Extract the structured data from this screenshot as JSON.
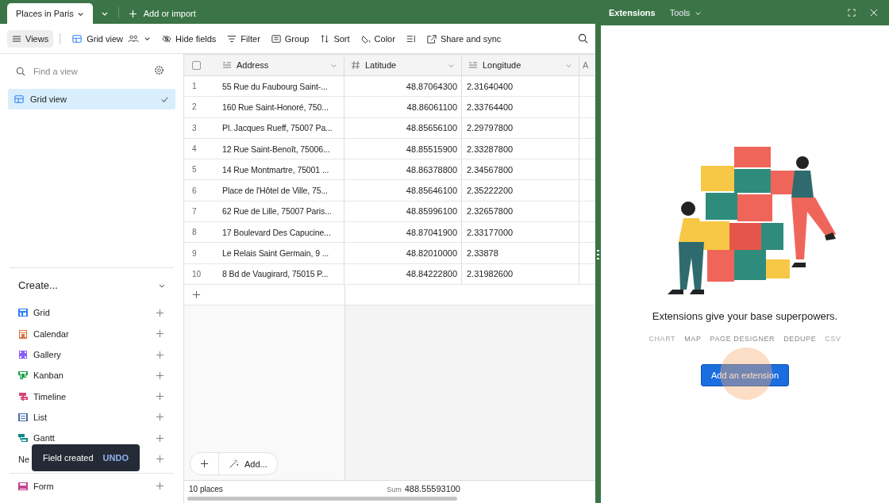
{
  "base_tabs": [
    {
      "label": "Places in Paris",
      "selected": true
    }
  ],
  "add_import": "Add or import",
  "toolbar": {
    "views": "Views",
    "view_name": "Grid view",
    "actions": [
      {
        "label": "Hide fields",
        "kind": "hide"
      },
      {
        "label": "Filter",
        "kind": "filter"
      },
      {
        "label": "Group",
        "kind": "group"
      },
      {
        "label": "Sort",
        "kind": "sort"
      },
      {
        "label": "Color",
        "kind": "color"
      },
      {
        "kind": "height"
      },
      {
        "label": "Share and sync",
        "kind": "share"
      }
    ]
  },
  "sidebar": {
    "search_placeholder": "Find a view",
    "views": [
      {
        "label": "Grid view",
        "selected": true
      }
    ],
    "create_title": "Create...",
    "create_items": [
      {
        "label": "Grid",
        "kind": "grid",
        "color": "#2d7ff9"
      },
      {
        "label": "Calendar",
        "kind": "calendar",
        "color": "#d9733f"
      },
      {
        "label": "Gallery",
        "kind": "gallery",
        "color": "#8b5cf6"
      },
      {
        "label": "Kanban",
        "kind": "kanban",
        "color": "#20a34a"
      },
      {
        "label": "Timeline",
        "kind": "timeline",
        "color": "#d6457a"
      },
      {
        "label": "List",
        "kind": "list",
        "color": "#4a6fa5"
      },
      {
        "label": "Gantt",
        "kind": "gantt",
        "color": "#0f8a8a"
      },
      {
        "label": "Ne"
      }
    ],
    "other_items": [
      {
        "label": "Form",
        "kind": "form",
        "color": "#c2458f"
      }
    ]
  },
  "toast": {
    "message": "Field created",
    "action": "UNDO"
  },
  "table": {
    "all_selected": false,
    "columns": [
      {
        "name": "Address",
        "kind": "text"
      },
      {
        "name": "Latitude",
        "kind": "number"
      },
      {
        "name": "Longitude",
        "kind": "text"
      },
      {
        "name": "A",
        "kind": "cut"
      }
    ],
    "rows": [
      {
        "n": "1",
        "address": "55 Rue du Faubourg Saint-...",
        "lat": "48.87064300",
        "lon": "2.31640400"
      },
      {
        "n": "2",
        "address": "160 Rue Saint-Honoré, 750...",
        "lat": "48.86061100",
        "lon": "2.33764400"
      },
      {
        "n": "3",
        "address": "Pl. Jacques Rueff, 75007 Pa...",
        "lat": "48.85656100",
        "lon": "2.29797800"
      },
      {
        "n": "4",
        "address": "12 Rue Saint-Benoît, 75006...",
        "lat": "48.85515900",
        "lon": "2.33287800"
      },
      {
        "n": "5",
        "address": "14 Rue Montmartre, 75001 ...",
        "lat": "48.86378800",
        "lon": "2.34567800"
      },
      {
        "n": "6",
        "address": "Place de l'Hôtel de Ville, 75...",
        "lat": "48.85646100",
        "lon": "2.35222200"
      },
      {
        "n": "7",
        "address": "62 Rue de Lille, 75007 Paris...",
        "lat": "48.85996100",
        "lon": "2.32657800"
      },
      {
        "n": "8",
        "address": "17 Boulevard Des Capucine...",
        "lat": "48.87041900",
        "lon": "2.33177000"
      },
      {
        "n": "9",
        "address": "Le Relais Saint Germain, 9 ...",
        "lat": "48.82010000",
        "lon": "2.33878"
      },
      {
        "n": "10",
        "address": "8 Bd de Vaugirard, 75015 P...",
        "lat": "48.84222800",
        "lon": "2.31982600"
      }
    ],
    "add_label": "Add...",
    "record_count": "10 places",
    "sum_label": "Sum",
    "sum_value": "488.55593100"
  },
  "extensions_panel": {
    "title": "Extensions",
    "tools": "Tools",
    "tagline": "Extensions give your base superpowers.",
    "extension_names": [
      {
        "label": "CHART",
        "faded": true
      },
      {
        "label": "MAP",
        "faded": false
      },
      {
        "label": "PAGE DESIGNER",
        "faded": false
      },
      {
        "label": "DEDUPE",
        "faded": false
      },
      {
        "label": "CSV",
        "faded": true
      }
    ],
    "button": "Add an extension"
  }
}
